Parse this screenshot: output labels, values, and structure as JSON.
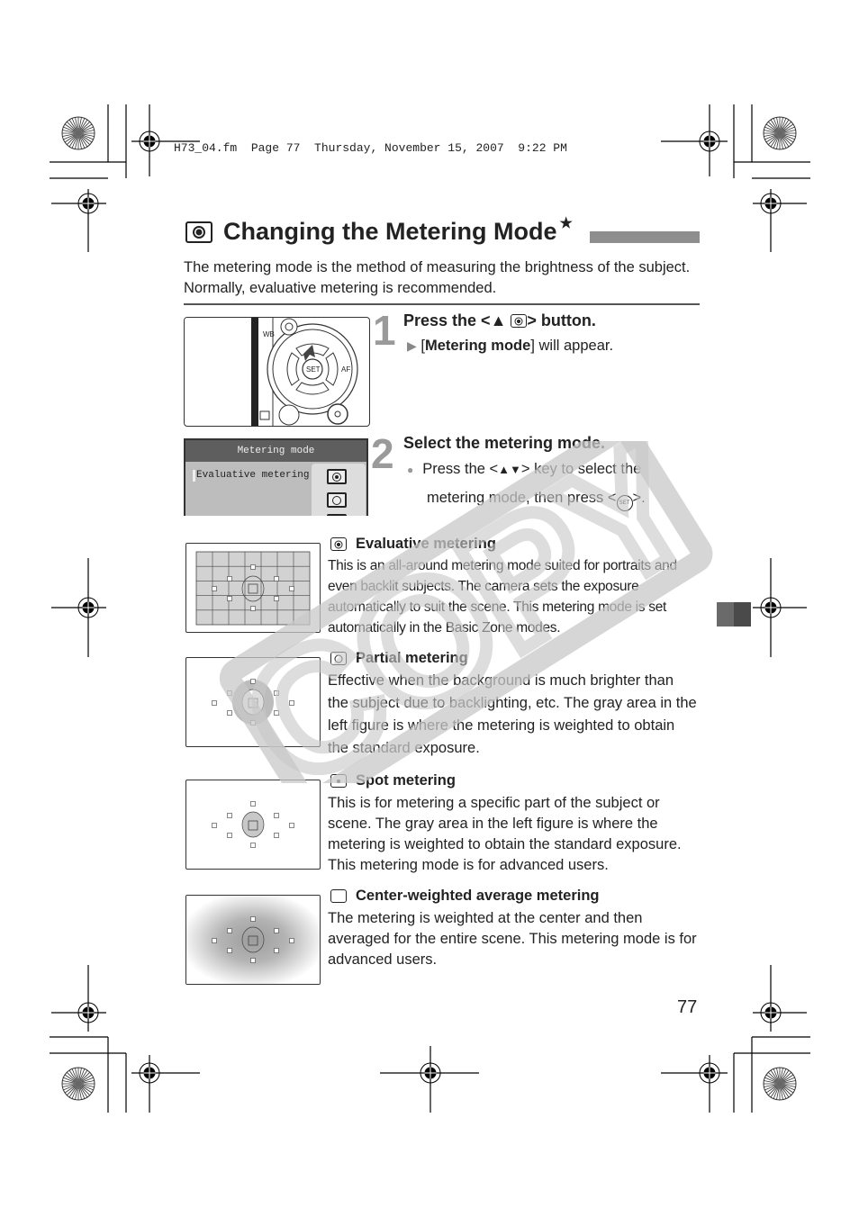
{
  "print_header": {
    "file": "H73_04.fm",
    "page_label": "Page 77",
    "date": "Thursday, November 15, 2007",
    "time": "9:22 PM"
  },
  "title": {
    "icon": "evaluative-metering-icon",
    "text": "Changing the Metering Mode",
    "star": "★"
  },
  "intro": "The metering mode is the method of measuring the brightness of the subject. Normally, evaluative metering is recommended.",
  "steps": [
    {
      "number": "1",
      "title_prefix": "Press the <",
      "title_arrow": "▲",
      "title_suffix": "> button.",
      "result_marker": "▶",
      "result_open": "[",
      "result_bold": "Metering mode",
      "result_close": "] will appear."
    },
    {
      "number": "2",
      "title": "Select the metering mode.",
      "bullet": "●",
      "text_1a": "Press the <",
      "text_1b": "▲▼",
      "text_1c": "> key to select the",
      "text_2a": "metering mode, then press <",
      "text_2b": "SET",
      "text_2c": ">."
    }
  ],
  "camera_illustration": {
    "labels": {
      "wb": "WB",
      "set": "SET",
      "af": "AF",
      "trash": "🗑",
      "play": "▶"
    }
  },
  "lcd_screen": {
    "header": "Metering mode",
    "selected_item": "Evaluative metering"
  },
  "modes": [
    {
      "icon": "evaluative-metering-icon",
      "title": "Evaluative metering",
      "text": "This is an all-around metering mode suited for portraits and even backlit subjects. The camera sets the exposure automatically to suit the scene. This metering mode is set automatically in the Basic Zone modes."
    },
    {
      "icon": "partial-metering-icon",
      "title": "Partial metering",
      "text": "Effective when the background is much brighter than the subject due to backlighting, etc. The gray area in the left figure is where the metering is weighted to obtain the standard exposure."
    },
    {
      "icon": "spot-metering-icon",
      "title": "Spot metering",
      "text": "This is for metering a specific part of the subject or scene. The gray area in the left figure is where the metering is weighted to obtain the standard exposure. This metering mode is for advanced users."
    },
    {
      "icon": "center-weighted-metering-icon",
      "title": "Center-weighted average metering",
      "text": "The metering is weighted at the center and then averaged for the entire scene. This metering mode is for advanced users."
    }
  ],
  "page_number": "77",
  "watermark": "COPY"
}
